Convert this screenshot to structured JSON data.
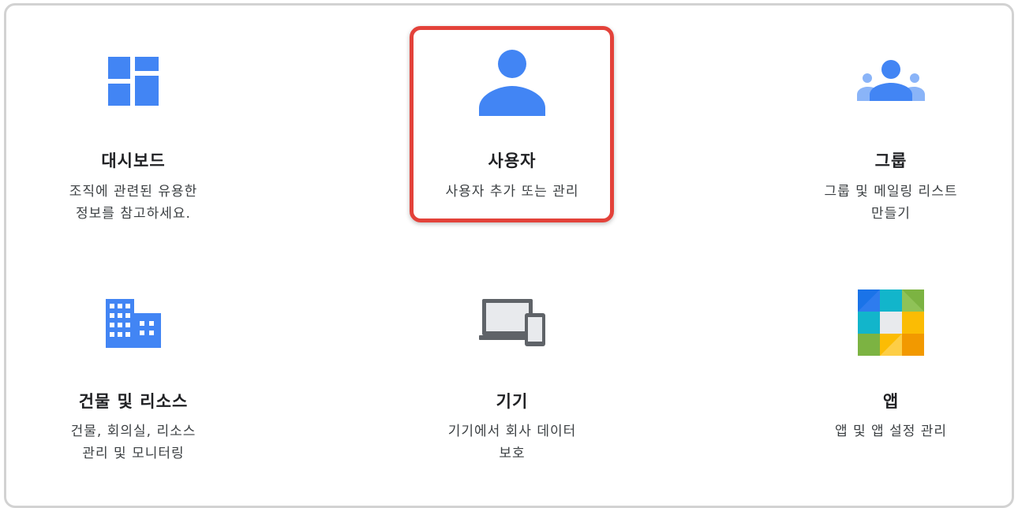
{
  "colors": {
    "icon_blue": "#4285f4",
    "highlight_red": "#e3423a",
    "frame_border": "#d2d2d2"
  },
  "tiles": [
    {
      "title": "대시보드",
      "desc_line1": "조직에 관련된 유용한",
      "desc_line2": "정보를 참고하세요.",
      "icon": "dashboard-icon"
    },
    {
      "title": "사용자",
      "desc_line1": "사용자 추가 또는 관리",
      "desc_line2": "",
      "icon": "user-icon",
      "selected": true
    },
    {
      "title": "그룹",
      "desc_line1": "그룹 및 메일링 리스트",
      "desc_line2": "만들기",
      "icon": "group-icon"
    },
    {
      "title": "건물 및 리소스",
      "desc_line1": "건물, 회의실, 리소스",
      "desc_line2": "관리 및 모니터링",
      "icon": "building-icon"
    },
    {
      "title": "기기",
      "desc_line1": "기기에서 회사 데이터",
      "desc_line2": "보호",
      "icon": "devices-icon"
    },
    {
      "title": "앱",
      "desc_line1": "앱 및 앱 설정 관리",
      "desc_line2": "",
      "icon": "apps-icon"
    }
  ]
}
